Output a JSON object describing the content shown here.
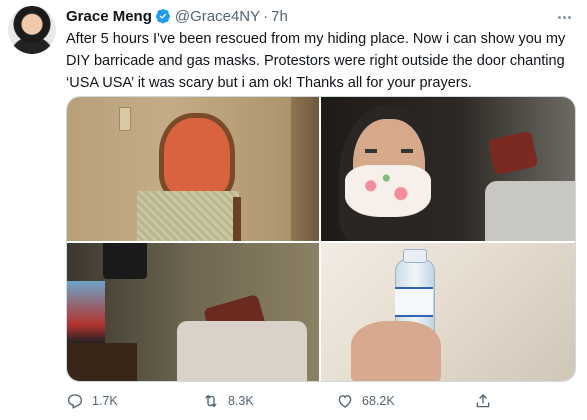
{
  "tweet": {
    "display_name": "Grace Meng",
    "handle": "@Grace4NY",
    "separator": "·",
    "time": "7h",
    "text": "After 5 hours I've been rescued from my hiding place. Now i can show you my DIY barricade and gas masks. Protestors were right outside the door chanting ‘USA USA’ it was scary but i am ok! Thanks all for your prayers.",
    "verified": true,
    "accent_color": "#1d9bf0"
  },
  "media": [
    {
      "icon": "photo-chair"
    },
    {
      "icon": "photo-selfie-mask"
    },
    {
      "icon": "photo-hotel-room"
    },
    {
      "icon": "photo-water-bottle"
    }
  ],
  "actions": {
    "reply_count": "1.7K",
    "retweet_count": "8.3K",
    "like_count": "68.2K",
    "icons": [
      "reply-icon",
      "retweet-icon",
      "like-icon",
      "share-icon"
    ]
  }
}
